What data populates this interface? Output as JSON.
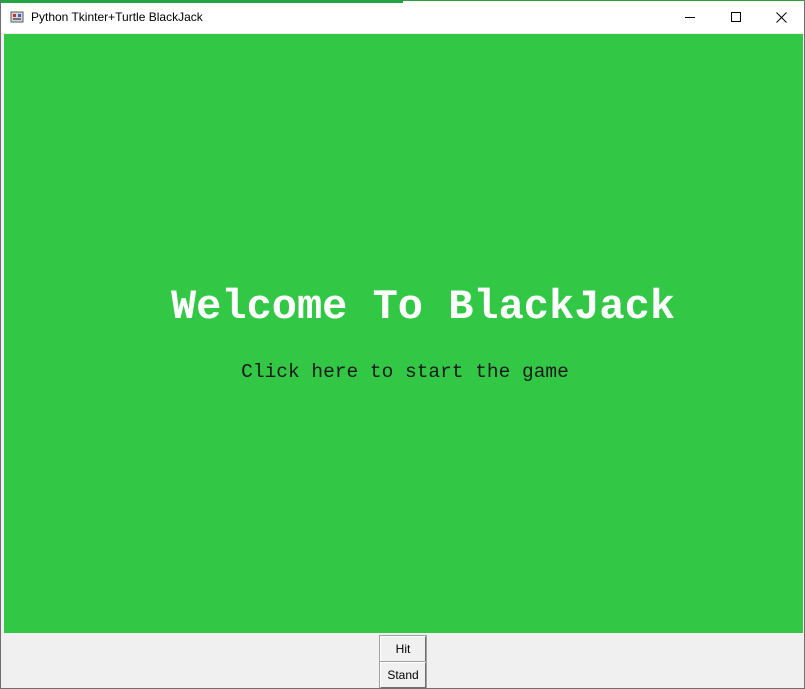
{
  "window": {
    "title": "Python Tkinter+Turtle BlackJack",
    "controls": {
      "minimize_icon": "minimize-icon",
      "maximize_icon": "maximize-icon",
      "close_icon": "close-icon"
    }
  },
  "canvas": {
    "background_color": "#32c846",
    "welcome_text": "Welcome To BlackJack",
    "start_prompt": "Click here to start the game"
  },
  "buttons": {
    "hit_label": "Hit",
    "stand_label": "Stand"
  }
}
